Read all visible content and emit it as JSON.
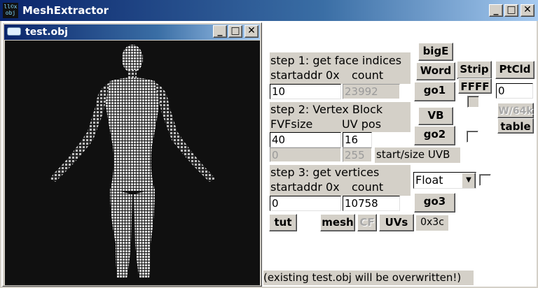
{
  "app": {
    "icon_text": "ll©x obj",
    "title": "MeshExtractor"
  },
  "window_buttons": {
    "minimize": "_",
    "maximize": "□",
    "close": "✕"
  },
  "child_window": {
    "title": "test.obj"
  },
  "step1": {
    "label": "step 1: get face indices",
    "startaddr_label": "startaddr 0x",
    "count_label": "count",
    "startaddr_value": "10",
    "count_value": "23992"
  },
  "step2": {
    "label": "step 2: Vertex Block",
    "fvf_label": "FVFsize",
    "uvpos_label": "UV pos",
    "fvf_value": "40",
    "uvpos_value": "16",
    "start_value": "0",
    "size_value": "255",
    "startsize_label": "start/size UVB"
  },
  "step3": {
    "label": "step 3: get vertices",
    "startaddr_label": "startaddr 0x",
    "count_label": "count",
    "startaddr_value": "0",
    "count_value": "10758",
    "format_selected": "Float"
  },
  "buttons": {
    "bigE": "bigE",
    "word": "Word",
    "strip": "Strip",
    "ptcld": "PtCld",
    "go1": "go1",
    "ffff": "FFFF",
    "vb": "VB",
    "w64k": "W/64k",
    "table": "table",
    "go2": "go2",
    "go3": "go3",
    "tut": "tut",
    "mesh": "mesh",
    "cf": "CF",
    "uvs": "UVs"
  },
  "ptcld_value": "0",
  "hex_readout": "0x3c",
  "status": "(existing test.obj will be overwritten!)"
}
